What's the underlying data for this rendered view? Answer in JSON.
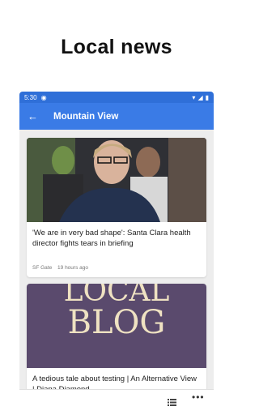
{
  "promo": {
    "title": "Local news"
  },
  "status": {
    "time": "5:30"
  },
  "appbar": {
    "title": "Mountain View"
  },
  "articles": [
    {
      "headline": "'We are in very bad shape': Santa Clara health director fights tears in briefing",
      "source": "SF Gate",
      "time": "19 hours ago"
    },
    {
      "headline": "A tedious tale about testing | An Alternative View | Diana Diamond",
      "image_text": [
        "LOCAL",
        "BLOG"
      ]
    }
  ]
}
